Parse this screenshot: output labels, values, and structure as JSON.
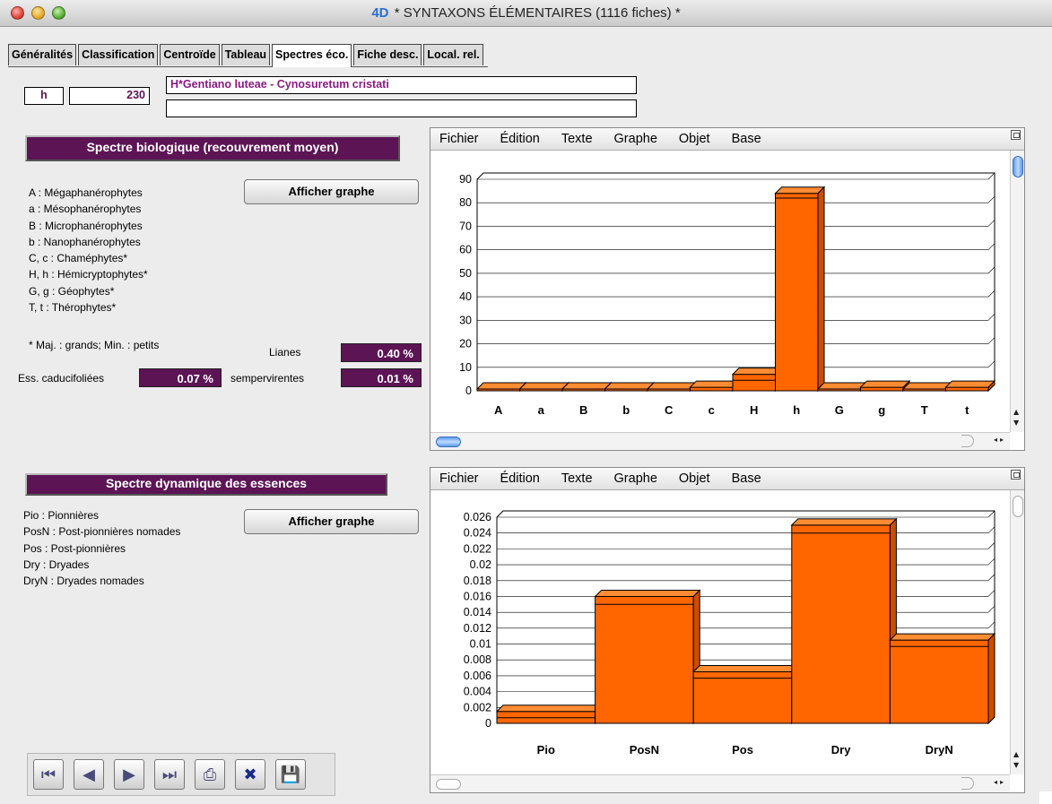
{
  "window": {
    "title": "* SYNTAXONS ÉLÉMENTAIRES (1116 fiches) *",
    "app_icon": "4D",
    "traffic_lights": [
      "close",
      "minimize",
      "zoom"
    ]
  },
  "tabs": [
    {
      "label": "Généralités",
      "active": false
    },
    {
      "label": "Classification",
      "active": false
    },
    {
      "label": "Centroïde",
      "active": false
    },
    {
      "label": "Tableau",
      "active": false
    },
    {
      "label": "Spectres éco.",
      "active": true
    },
    {
      "label": "Fiche desc.",
      "active": false
    },
    {
      "label": "Local. rel.",
      "active": false
    }
  ],
  "record": {
    "code": "h",
    "number": "230",
    "name": "H*Gentiano luteae - Cynosuretum cristati",
    "name2": ""
  },
  "bio": {
    "header": "Spectre biologique (recouvrement moyen)",
    "button": "Afficher graphe",
    "legend": [
      "A : Mégaphanérophytes",
      "a : Mésophanérophytes",
      "B : Microphanérophytes",
      "b : Nanophanérophytes",
      "C, c : Chaméphytes*",
      "H, h : Hémicryptophytes*",
      "G, g : Géophytes*",
      "T, t : Thérophytes*"
    ],
    "note": "* Maj. : grands; Min. : petits",
    "lianes_label": "Lianes",
    "lianes_value": "0.40 %",
    "ess_label": "Ess. caducifoliées",
    "ess_value": "0.07 %",
    "semp_label": "sempervirentes",
    "semp_value": "0.01 %"
  },
  "dyn": {
    "header": "Spectre dynamique des essences",
    "button": "Afficher graphe",
    "legend": [
      "Pio : Pionnières",
      "PosN : Post-pionnières nomades",
      "Pos : Post-pionnières",
      "Dry : Dryades",
      "DryN : Dryades nomades"
    ]
  },
  "chart_menu": [
    "Fichier",
    "Édition",
    "Texte",
    "Graphe",
    "Objet",
    "Base"
  ],
  "colors": {
    "accent": "#5c1455",
    "bar_fill": "#ff6600",
    "bar_top": "#ff8c33",
    "bar_side": "#cc4d00"
  },
  "toolbar_icons": [
    "first-record-icon",
    "previous-record-icon",
    "next-record-icon",
    "last-record-icon",
    "print-icon",
    "delete-icon",
    "save-record-icon"
  ],
  "chart_data": [
    {
      "type": "bar",
      "categories": [
        "A",
        "a",
        "B",
        "b",
        "C",
        "c",
        "H",
        "h",
        "G",
        "g",
        "T",
        "t"
      ],
      "values": [
        0,
        0,
        0,
        0,
        0,
        1.5,
        7,
        84,
        0,
        1.5,
        0,
        1.5
      ],
      "front_values": [
        0,
        0,
        0,
        0,
        0,
        0,
        4.5,
        82,
        0,
        0,
        0,
        0
      ],
      "ylim": [
        0,
        90
      ],
      "yticks": [
        "0",
        "10",
        "20",
        "30",
        "40",
        "50",
        "60",
        "70",
        "80",
        "90"
      ],
      "grid": true
    },
    {
      "type": "bar",
      "categories": [
        "Pio",
        "PosN",
        "Pos",
        "Dry",
        "DryN"
      ],
      "values": [
        0.0015,
        0.016,
        0.0065,
        0.025,
        0.0105
      ],
      "front_values": [
        0.0007,
        0.015,
        0.0057,
        0.024,
        0.0097
      ],
      "ylim": [
        0,
        0.026
      ],
      "yticks": [
        "0",
        "0.002",
        "0.004",
        "0.006",
        "0.008",
        "0.01",
        "0.012",
        "0.014",
        "0.016",
        "0.018",
        "0.02",
        "0.022",
        "0.024",
        "0.026"
      ],
      "grid": true
    }
  ]
}
